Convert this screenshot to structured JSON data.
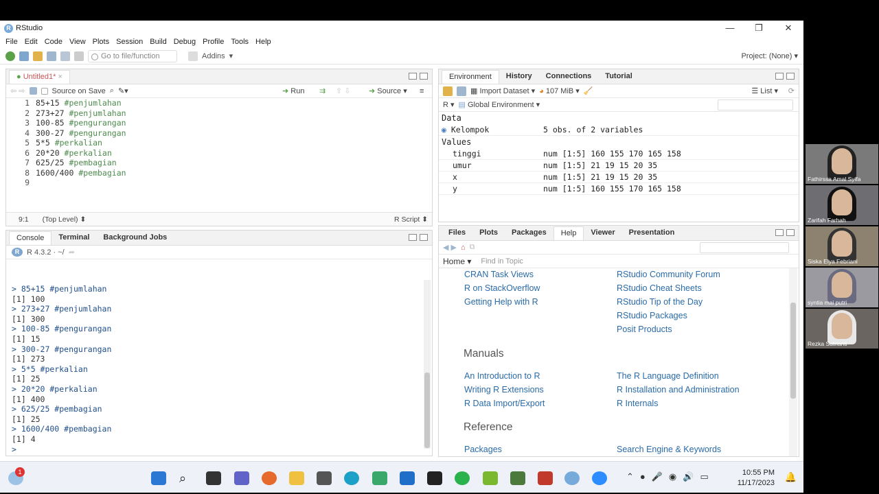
{
  "window": {
    "title": "RStudio"
  },
  "menu": [
    "File",
    "Edit",
    "Code",
    "View",
    "Plots",
    "Session",
    "Build",
    "Debug",
    "Profile",
    "Tools",
    "Help"
  ],
  "toolbar": {
    "goto_placeholder": "Go to file/function",
    "addins": "Addins",
    "project": "Project: (None)"
  },
  "source": {
    "tab": "Untitled1*",
    "source_on_save": "Source on Save",
    "run": "Run",
    "source_btn": "Source",
    "lines": [
      {
        "n": "1",
        "code": "85+15 ",
        "comment": "#penjumlahan"
      },
      {
        "n": "2",
        "code": "273+27 ",
        "comment": "#penjumlahan"
      },
      {
        "n": "3",
        "code": "100-85 ",
        "comment": "#pengurangan"
      },
      {
        "n": "4",
        "code": "300-27 ",
        "comment": "#pengurangan"
      },
      {
        "n": "5",
        "code": "5*5 ",
        "comment": "#perkalian"
      },
      {
        "n": "6",
        "code": "20*20 ",
        "comment": "#perkalian"
      },
      {
        "n": "7",
        "code": "625/25 ",
        "comment": "#pembagian"
      },
      {
        "n": "8",
        "code": "1600/400 ",
        "comment": "#pembagian"
      },
      {
        "n": "9",
        "code": "",
        "comment": ""
      }
    ],
    "status_pos": "9:1",
    "status_scope": "(Top Level)",
    "status_type": "R Script"
  },
  "console": {
    "tabs": [
      "Console",
      "Terminal",
      "Background Jobs"
    ],
    "version": "R 4.3.2 · ~/",
    "lines": [
      {
        "t": "in",
        "s": "> 85+15 #penjumlahan"
      },
      {
        "t": "out",
        "s": "[1] 100"
      },
      {
        "t": "in",
        "s": "> 273+27 #penjumlahan"
      },
      {
        "t": "out",
        "s": "[1] 300"
      },
      {
        "t": "in",
        "s": "> 100-85 #pengurangan"
      },
      {
        "t": "out",
        "s": "[1] 15"
      },
      {
        "t": "in",
        "s": "> 300-27 #pengurangan"
      },
      {
        "t": "out",
        "s": "[1] 273"
      },
      {
        "t": "in",
        "s": "> 5*5 #perkalian"
      },
      {
        "t": "out",
        "s": "[1] 25"
      },
      {
        "t": "in",
        "s": "> 20*20 #perkalian"
      },
      {
        "t": "out",
        "s": "[1] 400"
      },
      {
        "t": "in",
        "s": "> 625/25 #pembagian"
      },
      {
        "t": "out",
        "s": "[1] 25"
      },
      {
        "t": "in",
        "s": "> 1600/400 #pembagian"
      },
      {
        "t": "out",
        "s": "[1] 4"
      },
      {
        "t": "in",
        "s": "> "
      }
    ]
  },
  "env": {
    "tabs": [
      "Environment",
      "History",
      "Connections",
      "Tutorial"
    ],
    "import": "Import Dataset",
    "mem": "107 MiB",
    "list": "List",
    "lang": "R",
    "global": "Global Environment",
    "data_hdr": "Data",
    "values_hdr": "Values",
    "data": [
      {
        "name": "Kelompok",
        "val": "5 obs. of 2 variables"
      }
    ],
    "values": [
      {
        "name": "tinggi",
        "val": "num [1:5] 160 155 170 165 158"
      },
      {
        "name": "umur",
        "val": "num [1:5] 21 19 15 20 35"
      },
      {
        "name": "x",
        "val": "num [1:5] 21 19 15 20 35"
      },
      {
        "name": "y",
        "val": "num [1:5] 160 155 170 165 158"
      }
    ]
  },
  "help": {
    "tabs": [
      "Files",
      "Plots",
      "Packages",
      "Help",
      "Viewer",
      "Presentation"
    ],
    "home": "Home",
    "find_placeholder": "Find in Topic",
    "col1a": [
      "CRAN Task Views",
      "R on StackOverflow",
      "Getting Help with R"
    ],
    "col2a": [
      "RStudio Community Forum",
      "RStudio Cheat Sheets",
      "RStudio Tip of the Day",
      "RStudio Packages",
      "Posit Products"
    ],
    "manuals": "Manuals",
    "col1b": [
      "An Introduction to R",
      "Writing R Extensions",
      "R Data Import/Export"
    ],
    "col2b": [
      "The R Language Definition",
      "R Installation and Administration",
      "R Internals"
    ],
    "reference": "Reference",
    "col1c": [
      "Packages"
    ],
    "col2c": [
      "Search Engine & Keywords"
    ]
  },
  "taskbar": {
    "time": "10:55 PM",
    "date": "11/17/2023",
    "badge": "1"
  },
  "participants": [
    "Fathirssa Amal Syifa",
    "Zarifah Farhah",
    "Siska Elya Febriani",
    "syntia mai putri",
    "Rezka Sutrianti"
  ]
}
